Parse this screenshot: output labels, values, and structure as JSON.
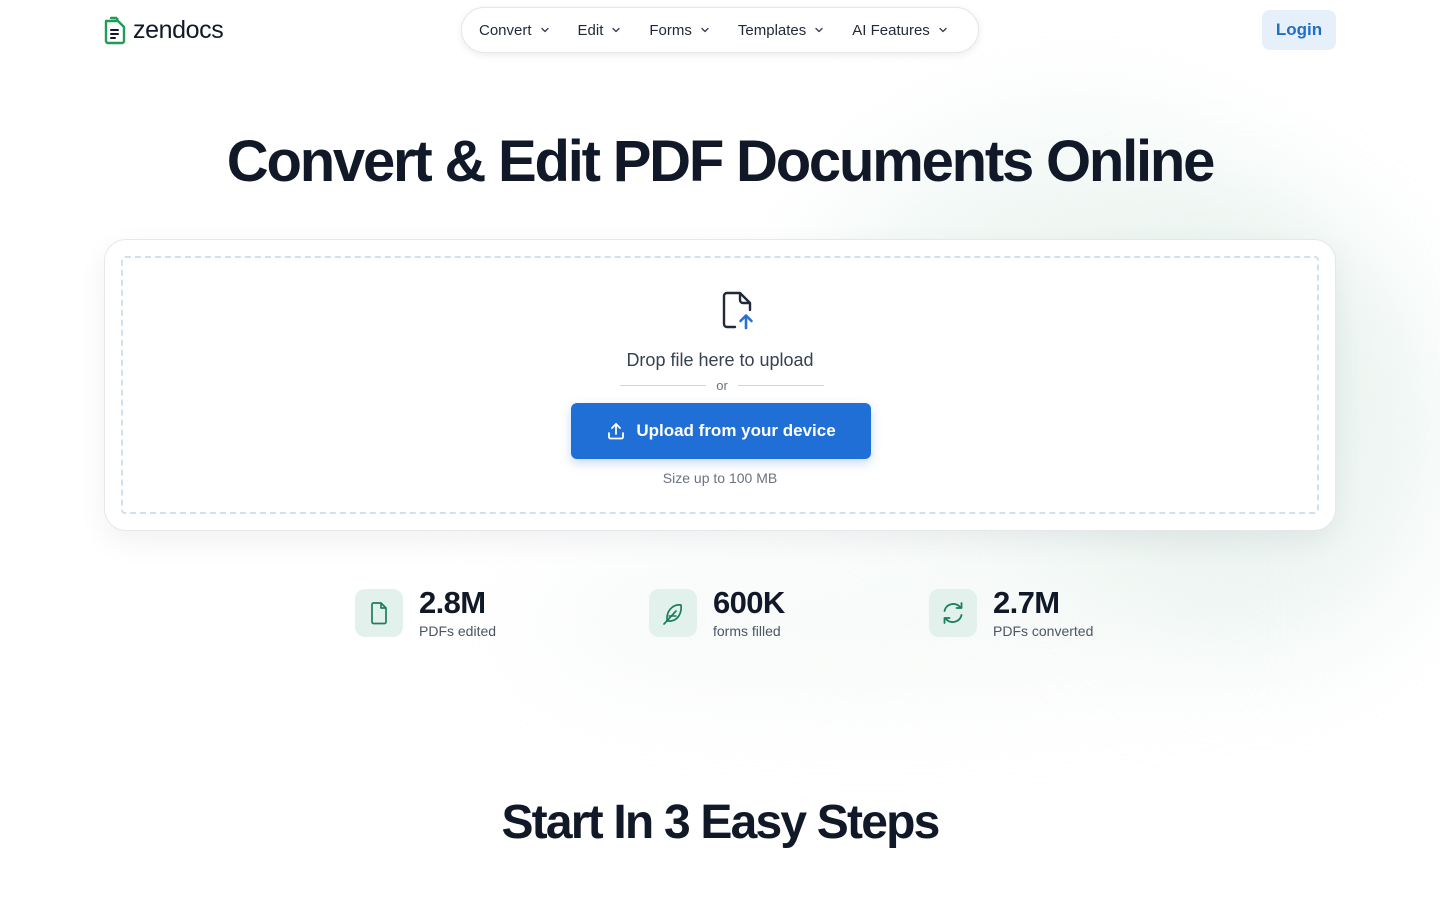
{
  "brand": {
    "name": "zendocs",
    "logo_icon": "document-logo-icon",
    "accent": "#1f9d55"
  },
  "nav": {
    "items": [
      {
        "label": "Convert"
      },
      {
        "label": "Edit"
      },
      {
        "label": "Forms"
      },
      {
        "label": "Templates"
      },
      {
        "label": "AI Features"
      }
    ],
    "login_label": "Login"
  },
  "hero": {
    "title": "Convert & Edit PDF Documents Online"
  },
  "upload": {
    "drop_text": "Drop file here to upload",
    "or_text": "or",
    "button_label": "Upload from your device",
    "size_note": "Size up to 100 MB",
    "button_color": "#1f6fd6"
  },
  "stats": [
    {
      "value": "2.8M",
      "label": "PDFs edited",
      "icon": "file-icon"
    },
    {
      "value": "600K",
      "label": "forms filled",
      "icon": "feather-pen-icon"
    },
    {
      "value": "2.7M",
      "label": "PDFs converted",
      "icon": "refresh-convert-icon"
    }
  ],
  "steps": {
    "title": "Start In 3 Easy Steps"
  },
  "colors": {
    "stat_icon_bg": "#e3f1ec",
    "stat_icon_fg": "#1a7f5a",
    "login_bg": "#e6f0fb",
    "login_fg": "#1f6fc7"
  }
}
